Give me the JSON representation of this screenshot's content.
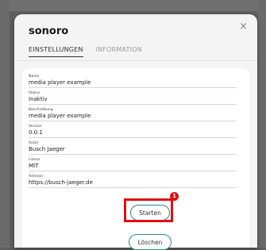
{
  "dialog": {
    "title": "sonoro",
    "close_glyph": "×"
  },
  "tabs": [
    {
      "label": "EINSTELLUNGEN",
      "active": true
    },
    {
      "label": "INFORMATION",
      "active": false
    }
  ],
  "fields": [
    {
      "label": "Name",
      "value": "media player example"
    },
    {
      "label": "Status",
      "value": "Inaktiv"
    },
    {
      "label": "Beschreibung",
      "value": "media player example"
    },
    {
      "label": "Version",
      "value": "0.0.1"
    },
    {
      "label": "Autor",
      "value": "Busch Jaeger"
    },
    {
      "label": "Lizenz",
      "value": "MIT"
    },
    {
      "label": "Adresse",
      "value": "https://busch-jaeger.de"
    }
  ],
  "buttons": {
    "start_label": "Starten",
    "delete_label": "Löschen"
  },
  "annotation": {
    "badge_number": "1",
    "highlight_color": "#e01010"
  },
  "colors": {
    "accent_border": "#2a8a8a",
    "dialog_bg": "#f4f4f4",
    "card_bg": "#ffffff"
  }
}
